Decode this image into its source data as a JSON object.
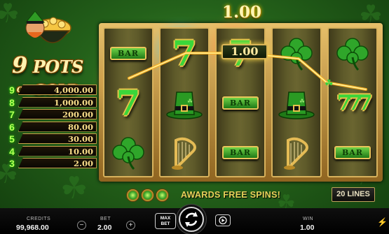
{
  "game": {
    "logo": {
      "title_big": "9",
      "title_word": "POTS",
      "title_of": "OF",
      "title_gold": "GOLD"
    },
    "top_win_amount": "1.00",
    "paytable": [
      {
        "count": "9",
        "prize": "4,000.00"
      },
      {
        "count": "8",
        "prize": "1,000.00"
      },
      {
        "count": "7",
        "prize": "200.00"
      },
      {
        "count": "6",
        "prize": "80.00"
      },
      {
        "count": "5",
        "prize": "30.00"
      },
      {
        "count": "4",
        "prize": "10.00"
      },
      {
        "count": "3",
        "prize": "2.00"
      }
    ],
    "reels": [
      [
        "BAR",
        "7",
        "clover"
      ],
      [
        "7",
        "hat",
        "harp"
      ],
      [
        "7",
        "BAR",
        "BAR"
      ],
      [
        "clover",
        "hat",
        "harp"
      ],
      [
        "clover",
        "777",
        "BAR"
      ]
    ],
    "bar_label": "BAR",
    "line_win_tag": "1.00",
    "awards_text": "AWARDS FREE SPINS!",
    "lines_label": "20 LINES",
    "colors": {
      "accent_gold": "#d8b25c",
      "seven_green": "#3ad63a",
      "win_line": "#ffb020"
    }
  },
  "controls": {
    "credits_label": "CREDITS",
    "credits_value": "99,968.00",
    "bet_label": "BET",
    "bet_value": "2.00",
    "minus_icon": "minus",
    "plus_icon": "plus",
    "maxbet_label_1": "MAX",
    "maxbet_label_2": "BET",
    "spin_icon": "refresh-icon",
    "autoplay_icon": "play-icon",
    "win_label": "WIN",
    "win_value": "1.00",
    "turbo_icon": "lightning-icon"
  }
}
